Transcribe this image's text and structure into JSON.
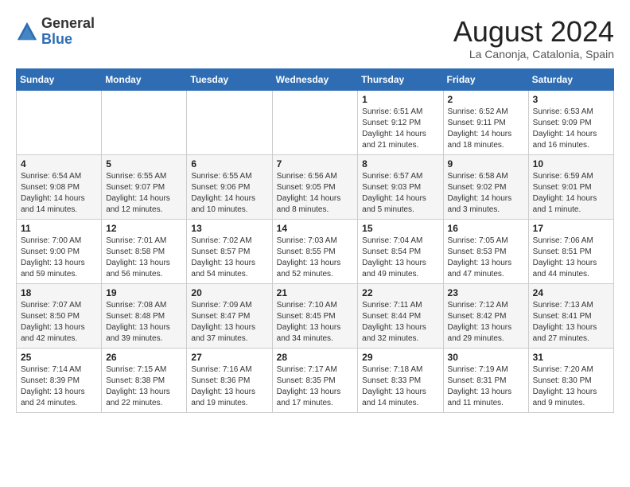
{
  "header": {
    "logo_general": "General",
    "logo_blue": "Blue",
    "month_title": "August 2024",
    "subtitle": "La Canonja, Catalonia, Spain"
  },
  "days_of_week": [
    "Sunday",
    "Monday",
    "Tuesday",
    "Wednesday",
    "Thursday",
    "Friday",
    "Saturday"
  ],
  "weeks": [
    [
      {
        "day": "",
        "info": ""
      },
      {
        "day": "",
        "info": ""
      },
      {
        "day": "",
        "info": ""
      },
      {
        "day": "",
        "info": ""
      },
      {
        "day": "1",
        "info": "Sunrise: 6:51 AM\nSunset: 9:12 PM\nDaylight: 14 hours\nand 21 minutes."
      },
      {
        "day": "2",
        "info": "Sunrise: 6:52 AM\nSunset: 9:11 PM\nDaylight: 14 hours\nand 18 minutes."
      },
      {
        "day": "3",
        "info": "Sunrise: 6:53 AM\nSunset: 9:09 PM\nDaylight: 14 hours\nand 16 minutes."
      }
    ],
    [
      {
        "day": "4",
        "info": "Sunrise: 6:54 AM\nSunset: 9:08 PM\nDaylight: 14 hours\nand 14 minutes."
      },
      {
        "day": "5",
        "info": "Sunrise: 6:55 AM\nSunset: 9:07 PM\nDaylight: 14 hours\nand 12 minutes."
      },
      {
        "day": "6",
        "info": "Sunrise: 6:55 AM\nSunset: 9:06 PM\nDaylight: 14 hours\nand 10 minutes."
      },
      {
        "day": "7",
        "info": "Sunrise: 6:56 AM\nSunset: 9:05 PM\nDaylight: 14 hours\nand 8 minutes."
      },
      {
        "day": "8",
        "info": "Sunrise: 6:57 AM\nSunset: 9:03 PM\nDaylight: 14 hours\nand 5 minutes."
      },
      {
        "day": "9",
        "info": "Sunrise: 6:58 AM\nSunset: 9:02 PM\nDaylight: 14 hours\nand 3 minutes."
      },
      {
        "day": "10",
        "info": "Sunrise: 6:59 AM\nSunset: 9:01 PM\nDaylight: 14 hours\nand 1 minute."
      }
    ],
    [
      {
        "day": "11",
        "info": "Sunrise: 7:00 AM\nSunset: 9:00 PM\nDaylight: 13 hours\nand 59 minutes."
      },
      {
        "day": "12",
        "info": "Sunrise: 7:01 AM\nSunset: 8:58 PM\nDaylight: 13 hours\nand 56 minutes."
      },
      {
        "day": "13",
        "info": "Sunrise: 7:02 AM\nSunset: 8:57 PM\nDaylight: 13 hours\nand 54 minutes."
      },
      {
        "day": "14",
        "info": "Sunrise: 7:03 AM\nSunset: 8:55 PM\nDaylight: 13 hours\nand 52 minutes."
      },
      {
        "day": "15",
        "info": "Sunrise: 7:04 AM\nSunset: 8:54 PM\nDaylight: 13 hours\nand 49 minutes."
      },
      {
        "day": "16",
        "info": "Sunrise: 7:05 AM\nSunset: 8:53 PM\nDaylight: 13 hours\nand 47 minutes."
      },
      {
        "day": "17",
        "info": "Sunrise: 7:06 AM\nSunset: 8:51 PM\nDaylight: 13 hours\nand 44 minutes."
      }
    ],
    [
      {
        "day": "18",
        "info": "Sunrise: 7:07 AM\nSunset: 8:50 PM\nDaylight: 13 hours\nand 42 minutes."
      },
      {
        "day": "19",
        "info": "Sunrise: 7:08 AM\nSunset: 8:48 PM\nDaylight: 13 hours\nand 39 minutes."
      },
      {
        "day": "20",
        "info": "Sunrise: 7:09 AM\nSunset: 8:47 PM\nDaylight: 13 hours\nand 37 minutes."
      },
      {
        "day": "21",
        "info": "Sunrise: 7:10 AM\nSunset: 8:45 PM\nDaylight: 13 hours\nand 34 minutes."
      },
      {
        "day": "22",
        "info": "Sunrise: 7:11 AM\nSunset: 8:44 PM\nDaylight: 13 hours\nand 32 minutes."
      },
      {
        "day": "23",
        "info": "Sunrise: 7:12 AM\nSunset: 8:42 PM\nDaylight: 13 hours\nand 29 minutes."
      },
      {
        "day": "24",
        "info": "Sunrise: 7:13 AM\nSunset: 8:41 PM\nDaylight: 13 hours\nand 27 minutes."
      }
    ],
    [
      {
        "day": "25",
        "info": "Sunrise: 7:14 AM\nSunset: 8:39 PM\nDaylight: 13 hours\nand 24 minutes."
      },
      {
        "day": "26",
        "info": "Sunrise: 7:15 AM\nSunset: 8:38 PM\nDaylight: 13 hours\nand 22 minutes."
      },
      {
        "day": "27",
        "info": "Sunrise: 7:16 AM\nSunset: 8:36 PM\nDaylight: 13 hours\nand 19 minutes."
      },
      {
        "day": "28",
        "info": "Sunrise: 7:17 AM\nSunset: 8:35 PM\nDaylight: 13 hours\nand 17 minutes."
      },
      {
        "day": "29",
        "info": "Sunrise: 7:18 AM\nSunset: 8:33 PM\nDaylight: 13 hours\nand 14 minutes."
      },
      {
        "day": "30",
        "info": "Sunrise: 7:19 AM\nSunset: 8:31 PM\nDaylight: 13 hours\nand 11 minutes."
      },
      {
        "day": "31",
        "info": "Sunrise: 7:20 AM\nSunset: 8:30 PM\nDaylight: 13 hours\nand 9 minutes."
      }
    ]
  ]
}
